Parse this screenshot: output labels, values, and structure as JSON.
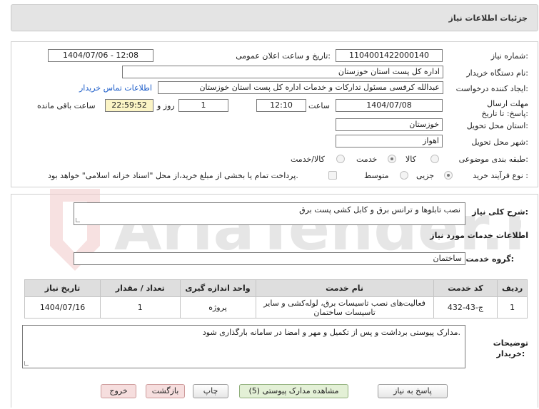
{
  "header": {
    "title": "جزئیات اطلاعات نیاز"
  },
  "form": {
    "need_number": {
      "label": "شماره نیاز:",
      "value": "1104001422000140"
    },
    "announce_date": {
      "label": "تاریخ و ساعت اعلان عمومی:",
      "value": "1404/07/06 - 12:08"
    },
    "buyer_org": {
      "label": "نام دستگاه خریدار:",
      "value": "اداره کل پست استان خوزستان"
    },
    "requester": {
      "label": "ایجاد کننده درخواست:",
      "value": "عبدالله کرفسی مسئول تدارکات و خدمات اداره کل پست استان خوزستان"
    },
    "contact_link": "اطلاعات تماس خریدار",
    "deadline": {
      "label": "مهلت ارسال پاسخ: تا تاریخ:",
      "date": "1404/07/08",
      "time_label": "ساعت",
      "time": "12:10",
      "days": "1",
      "days_label": "روز و",
      "remaining": "22:59:52",
      "remaining_label": "ساعت باقی مانده"
    },
    "province": {
      "label": "استان محل تحویل:",
      "value": "خوزستان"
    },
    "city": {
      "label": "شهر محل تحویل:",
      "value": "اهواز"
    },
    "category": {
      "label": "طبقه بندی موضوعی:",
      "options": [
        "کالا",
        "خدمت",
        "کالا/خدمت"
      ],
      "selected": "خدمت"
    },
    "purchase_type": {
      "label": "نوع فرآیند خرید :",
      "options": [
        "جزیی",
        "متوسط"
      ],
      "selected": "جزیی",
      "treasury_note": "پرداخت تمام یا بخشی از مبلغ خرید،از محل \"اسناد خزانه اسلامی\" خواهد بود."
    }
  },
  "need_summary": {
    "label": "شرح کلی نیاز:",
    "value": "نصب تابلوها و ترانس برق و کابل کشی پست برق"
  },
  "services_info": {
    "title": "اطلاعات خدمات مورد نیاز"
  },
  "service_group": {
    "label": "گروه خدمت:",
    "value": "ساختمان"
  },
  "table": {
    "headers": [
      "ردیف",
      "کد خدمت",
      "نام خدمت",
      "واحد اندازه گیری",
      "تعداد / مقدار",
      "تاریخ نیاز"
    ],
    "rows": [
      {
        "row": "1",
        "code": "ج-43-432",
        "name_line1": "فعالیت‌های نصب تاسیسات برق، لوله‌کشی و سایر",
        "name_line2": "تاسیسات ساختمان",
        "unit": "پروژه",
        "qty": "1",
        "date": "1404/07/16"
      }
    ]
  },
  "buyer_notes": {
    "label_line1": "توضیحات",
    "label_line2": "خریدار:",
    "value": "مدارک پیوستی برداشت و پس از تکمیل و مهر و امضا در سامانه بارگذاری شود."
  },
  "buttons": {
    "reply": "پاسخ به نیاز",
    "view_docs": "مشاهده مدارک پیوستی (5)",
    "print": "چاپ",
    "back": "بازگشت",
    "exit": "خروج"
  },
  "watermark": {
    "text": "AriaTender.neT"
  }
}
